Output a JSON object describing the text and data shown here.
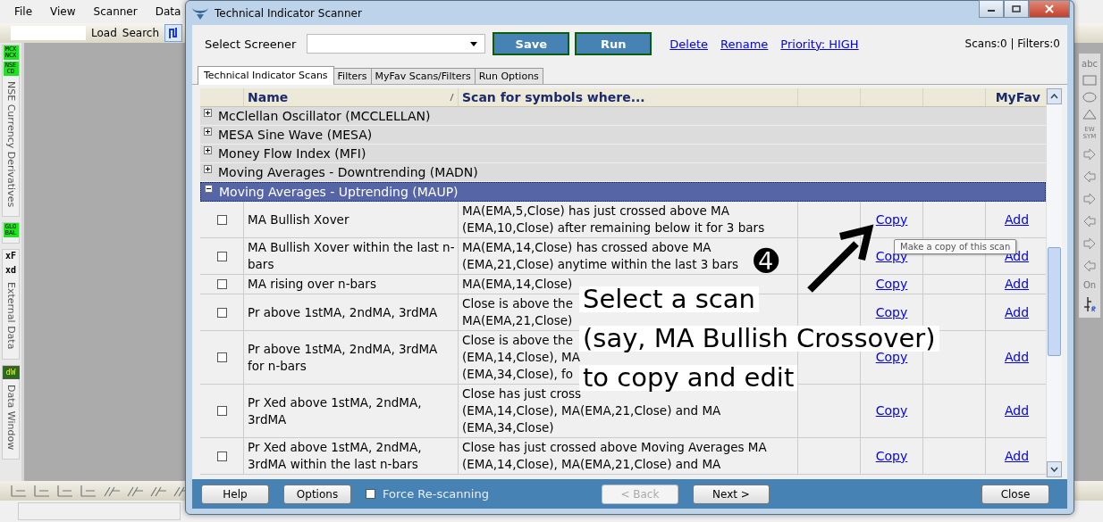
{
  "app": {
    "menu": [
      "File",
      "View",
      "Scanner",
      "Data"
    ],
    "toolbar": {
      "buttons": [
        "Load",
        "Search"
      ]
    },
    "side_panels": [
      {
        "badges": [
          {
            "kind": "green",
            "lines": [
              "MCX",
              "NCX"
            ]
          },
          {
            "kind": "green",
            "lines": [
              "NSE",
              "CD"
            ]
          }
        ],
        "label": "NSE Currency Derivatives"
      },
      {
        "badges": [
          {
            "kind": "green",
            "lines": [
              "GLO",
              "BAL"
            ]
          }
        ]
      },
      {
        "badges": [
          {
            "kind": "plain",
            "lines": [
              "xF"
            ]
          },
          {
            "kind": "plain",
            "lines": [
              "xd"
            ]
          }
        ],
        "label": "External Data"
      },
      {
        "badges": [
          {
            "kind": "dark",
            "lines": [
              "dW"
            ]
          }
        ],
        "label": "Data Window"
      }
    ],
    "right_toolbar": {
      "labels": [
        "abc",
        "EW SYM",
        "On"
      ]
    }
  },
  "dialog": {
    "title": "Technical Indicator Scanner",
    "screener": {
      "label": "Select Screener"
    },
    "buttons": [
      "Save",
      "Run"
    ],
    "links": [
      "Delete",
      "Rename",
      "Priority: HIGH"
    ],
    "status": "Scans:0 | Filters:0",
    "tabs": [
      {
        "label": "Technical Indicator Scans",
        "selected": true
      },
      {
        "label": "Filters",
        "selected": false
      },
      {
        "label": "MyFav Scans/Filters",
        "selected": false
      },
      {
        "label": "Run Options",
        "selected": false
      }
    ],
    "columns": [
      "Name",
      "Scan for symbols where...",
      "MyFav"
    ],
    "groups": [
      {
        "label": "McClellan Oscillator (MCCLELLAN)",
        "expanded": false,
        "selected": false
      },
      {
        "label": "MESA Sine Wave (MESA)",
        "expanded": false,
        "selected": false
      },
      {
        "label": "Money Flow Index (MFI)",
        "expanded": false,
        "selected": false
      },
      {
        "label": "Moving Averages - Downtrending (MADN)",
        "expanded": false,
        "selected": false
      },
      {
        "label": "Moving Averages - Uptrending (MAUP)",
        "expanded": true,
        "selected": true
      }
    ],
    "rows": [
      {
        "checked": false,
        "name": [
          "MA Bullish Xover"
        ],
        "scan": [
          "MA(EMA,5,Close) has just crossed above MA",
          "(EMA,10,Close) after remaining below it for 3 bars"
        ],
        "copy": "Copy",
        "fav": "Add"
      },
      {
        "checked": false,
        "name": [
          "MA Bullish Xover within the last n-",
          "bars"
        ],
        "scan": [
          "MA(EMA,14,Close) has crossed above MA",
          "(EMA,21,Close) anytime within the last 3 bars"
        ],
        "copy": "Copy",
        "fav": "Add"
      },
      {
        "checked": false,
        "name": [
          "MA rising over n-bars"
        ],
        "scan": [
          "MA(EMA,14,Close)"
        ],
        "copy": "Copy",
        "fav": "Add"
      },
      {
        "checked": false,
        "name": [
          "Pr above 1stMA, 2ndMA, 3rdMA"
        ],
        "scan": [
          "Close is above the",
          "MA(EMA,21,Close)"
        ],
        "copy": "Copy",
        "fav": "Add"
      },
      {
        "checked": false,
        "name": [
          "Pr above 1stMA, 2ndMA, 3rdMA",
          "for n-bars"
        ],
        "scan": [
          "Close is above the",
          "(EMA,14,Close), MA",
          "(EMA,34,Close), fo"
        ],
        "copy": "Copy",
        "fav": "Add"
      },
      {
        "checked": false,
        "name": [
          "Pr Xed above 1stMA, 2ndMA,",
          "3rdMA"
        ],
        "scan": [
          "Close has just cross",
          "(EMA,14,Close), MA(EMA,21,Close) and MA",
          "(EMA,34,Close)"
        ],
        "copy": "Copy",
        "fav": "Add"
      },
      {
        "checked": false,
        "name": [
          "Pr Xed above 1stMA, 2ndMA,",
          "3rdMA within the last n-bars"
        ],
        "scan": [
          "Close has just crossed above Moving Averages MA",
          "(EMA,14,Close), MA(EMA,21,Close) and MA"
        ],
        "copy": "Copy",
        "fav": "Add"
      }
    ],
    "tooltip": "Make a copy of this scan",
    "annotation": {
      "step": "➍",
      "lines": [
        "Select a scan",
        "(say, MA Bullish Crossover)",
        "to copy and edit"
      ]
    },
    "footer": {
      "buttons": [
        {
          "label": "Help",
          "disabled": false
        },
        {
          "label": "Options",
          "disabled": false
        }
      ],
      "force_rescan": {
        "label": "Force Re-scanning",
        "checked": false
      },
      "nav": [
        {
          "label": "< Back",
          "disabled": true
        },
        {
          "label": "Next >",
          "disabled": false
        }
      ],
      "close": "Close"
    }
  }
}
